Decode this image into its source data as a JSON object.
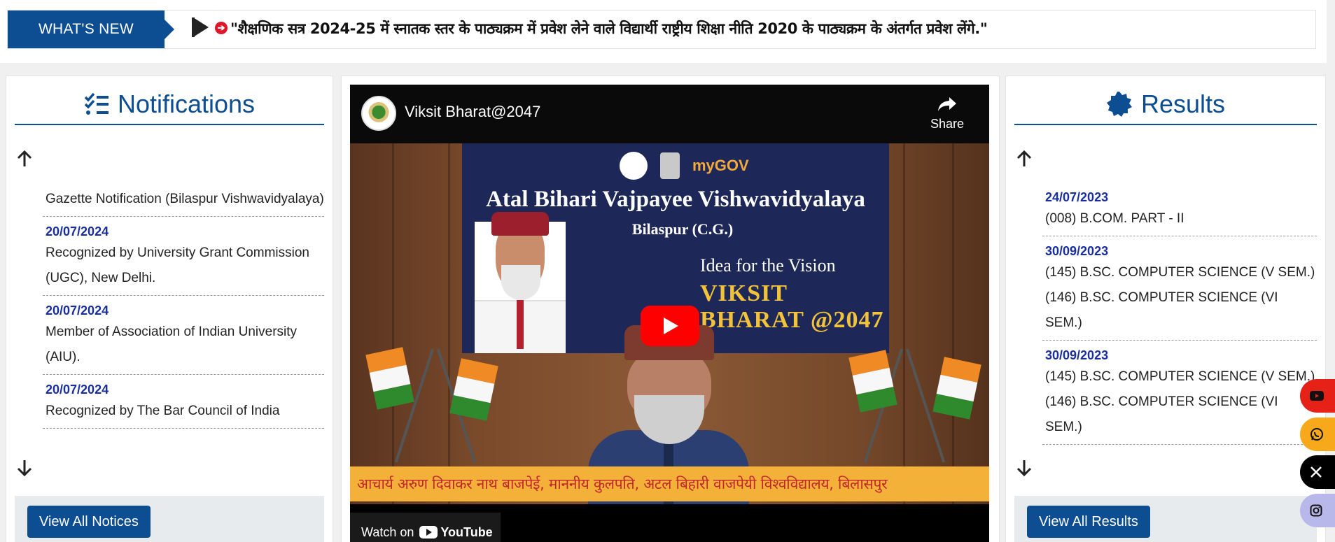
{
  "whats_new": {
    "label": "WHAT'S NEW",
    "text": "\"शैक्षणिक सत्र 2024-25 में स्नातक स्तर के पाठ्यक्रम में प्रवेश लेने वाले विद्यार्थी राष्ट्रीय शिक्षा नीति 2020 के पाठ्यक्रम के अंतर्गत प्रवेश लेंगे.\""
  },
  "notifications": {
    "title": "Notifications",
    "items": [
      {
        "date": "",
        "title": "Gazette Notification (Bilaspur Vishwavidyalaya)"
      },
      {
        "date": "20/07/2024",
        "title": "Recognized by University Grant Commission (UGC), New Delhi."
      },
      {
        "date": "20/07/2024",
        "title": "Member of Association of Indian University (AIU)."
      },
      {
        "date": "20/07/2024",
        "title": "Recognized by The Bar Council of India"
      }
    ],
    "button": "View All Notices"
  },
  "video": {
    "title": "Viksit Bharat@2047",
    "share": "Share",
    "watch_on": "Watch on",
    "youtube": "YouTube",
    "banner_title": "Atal Bihari Vajpayee Vishwavidyalaya",
    "banner_sub": "Bilaspur (C.G.)",
    "banner_idea": "Idea for the Vision",
    "banner_viksit": "VIKSIT BHARAT @2047",
    "mygov": "myGOV",
    "hindi_strip": "आचार्य अरुण दिवाकर नाथ बाजपेई,   माननीय कुलपति, अटल बिहारी वाजपेयी विश्वविद्यालय, बिलासपुर"
  },
  "results": {
    "title": "Results",
    "items": [
      {
        "date": "24/07/2023",
        "title": "(008) B.COM. PART - II"
      },
      {
        "date": "30/09/2023",
        "title": "(145) B.SC. COMPUTER SCIENCE (V SEM.)(146) B.SC. COMPUTER SCIENCE (VI SEM.)"
      },
      {
        "date": "30/09/2023",
        "title": "(145) B.SC. COMPUTER SCIENCE (V SEM.) (146) B.SC. COMPUTER SCIENCE (VI SEM.)"
      }
    ],
    "button": "View All Results"
  },
  "social": {
    "icons": [
      "youtube-icon",
      "whatsapp-icon",
      "x-icon",
      "instagram-icon"
    ]
  },
  "colors": {
    "brand": "#0d4d91",
    "date": "#1a2f9e",
    "youtube": "#e62117",
    "whatsapp": "#f7a81b",
    "instagram": "#b9b8ea"
  }
}
